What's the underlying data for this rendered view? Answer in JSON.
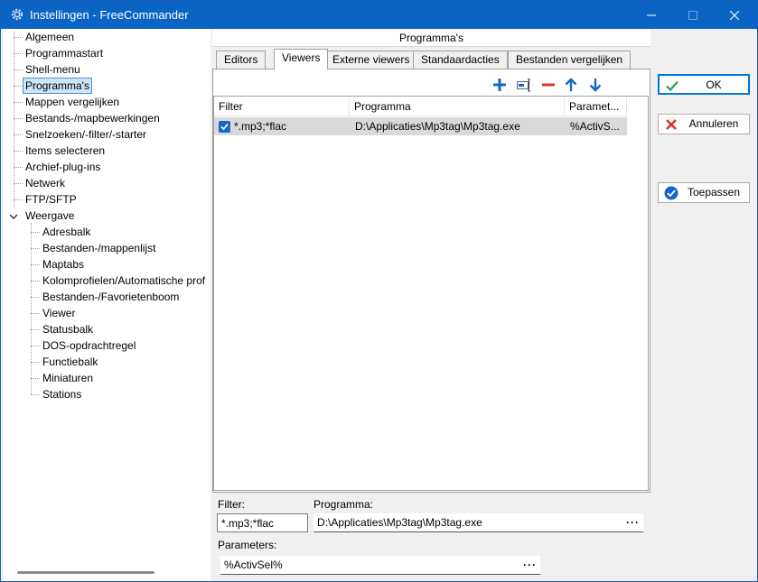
{
  "window": {
    "title": "Instellingen - FreeCommander"
  },
  "tree": {
    "items": [
      {
        "label": "Algemeen"
      },
      {
        "label": "Programmastart"
      },
      {
        "label": "Shell-menu"
      },
      {
        "label": "Programma's",
        "selected": true
      },
      {
        "label": "Mappen vergelijken"
      },
      {
        "label": "Bestands-/mapbewerkingen"
      },
      {
        "label": "Snelzoeken/-filter/-starter"
      },
      {
        "label": "Items selecteren"
      },
      {
        "label": "Archief-plug-ins"
      },
      {
        "label": "Netwerk"
      },
      {
        "label": "FTP/SFTP"
      },
      {
        "label": "Weergave",
        "expanded": true
      }
    ],
    "subitems": [
      {
        "label": "Adresbalk"
      },
      {
        "label": "Bestanden-/mappenlijst"
      },
      {
        "label": "Maptabs"
      },
      {
        "label": "Kolomprofielen/Automatische prof"
      },
      {
        "label": "Bestanden-/Favorietenboom"
      },
      {
        "label": "Viewer"
      },
      {
        "label": "Statusbalk"
      },
      {
        "label": "DOS-opdrachtregel"
      },
      {
        "label": "Functiebalk"
      },
      {
        "label": "Miniaturen"
      },
      {
        "label": "Stations"
      }
    ]
  },
  "panel": {
    "title": "Programma's",
    "tabs": [
      {
        "label": "Editors"
      },
      {
        "label": "Viewers",
        "active": true
      },
      {
        "label": "Externe viewers"
      },
      {
        "label": "Standaardacties"
      },
      {
        "label": "Bestanden vergelijken"
      }
    ],
    "toolbar": [
      "add-icon",
      "edit-field-icon",
      "remove-icon",
      "move-up-icon",
      "move-down-icon"
    ],
    "grid": {
      "columns": [
        "Filter",
        "Programma",
        "Paramet..."
      ],
      "rows": [
        {
          "checked": true,
          "filter": "*.mp3;*flac",
          "program": "D:\\Applicaties\\Mp3tag\\Mp3tag.exe",
          "params": "%ActivS..."
        }
      ]
    },
    "editor": {
      "filter_label": "Filter:",
      "filter_value": "*.mp3;*flac",
      "program_label": "Programma:",
      "program_value": "D:\\Applicaties\\Mp3tag\\Mp3tag.exe",
      "params_label": "Parameters:",
      "params_value": "%ActivSel%",
      "browse": "···"
    }
  },
  "buttons": {
    "ok": "OK",
    "cancel": "Annuleren",
    "apply": "Toepassen"
  },
  "colors": {
    "titlebar": "#0a64c4",
    "accent": "#1467c6",
    "remove": "#d9352a"
  }
}
